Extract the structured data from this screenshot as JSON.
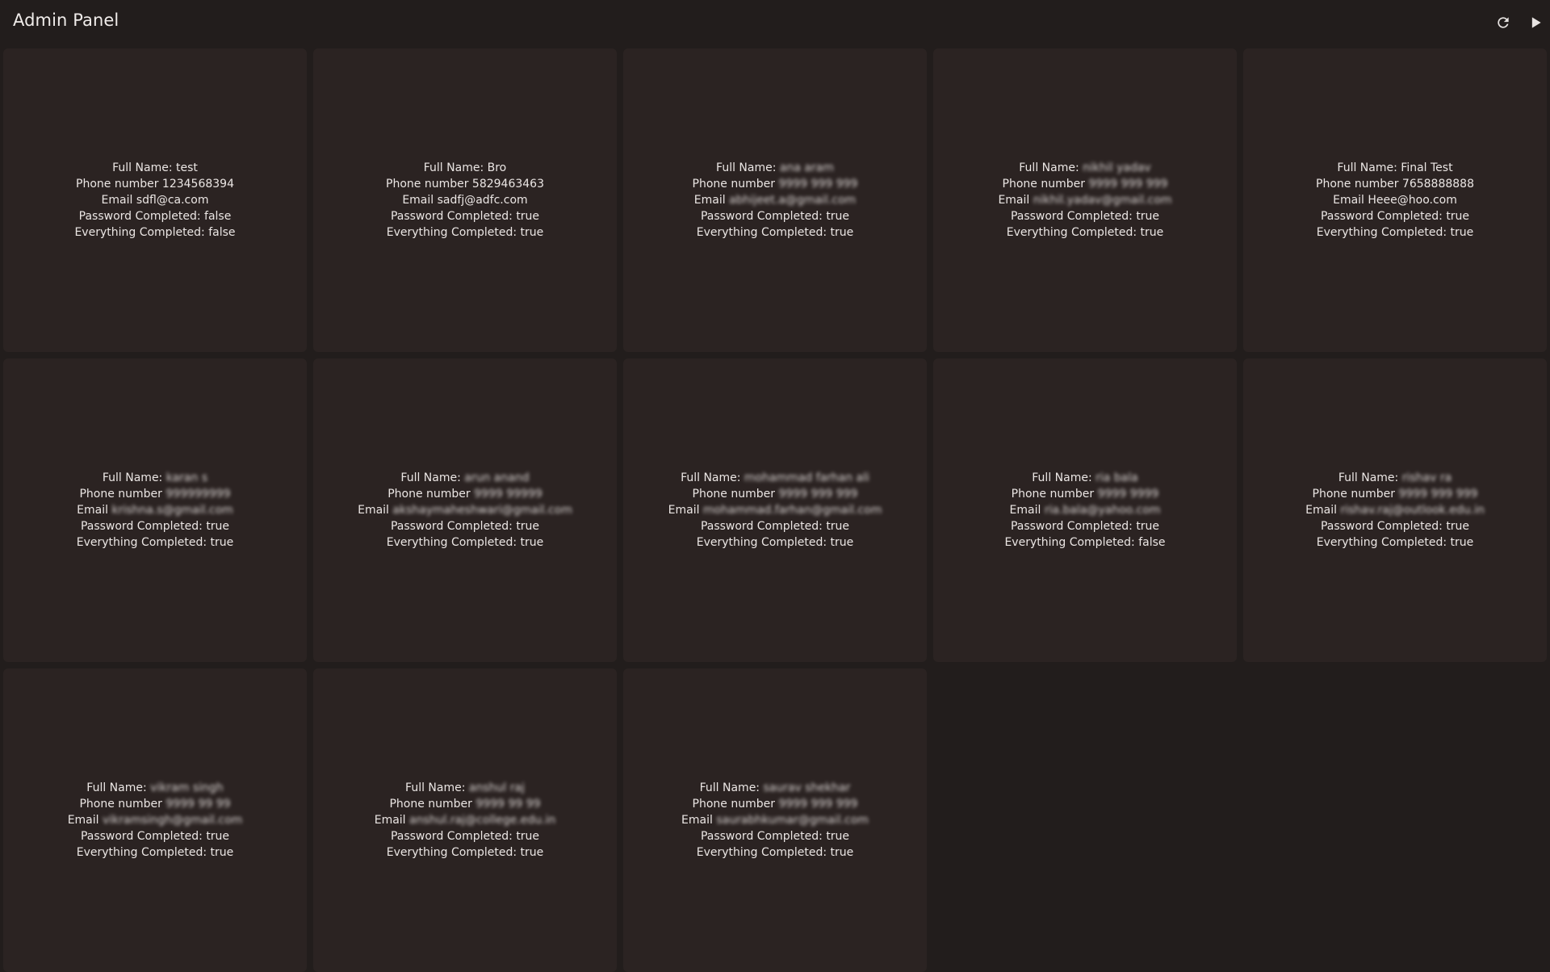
{
  "header": {
    "title": "Admin Panel",
    "refresh_icon": "refresh-icon",
    "play_icon": "play-icon"
  },
  "labels": {
    "full_name": "Full Name: ",
    "phone": "Phone number ",
    "email": "Email ",
    "password": "Password Completed: ",
    "everything": "Everything Completed: "
  },
  "users": [
    {
      "full_name": "test",
      "phone": "1234568394",
      "email": "sdfl@ca.com",
      "password_completed": "false",
      "everything_completed": "false",
      "redacted": false
    },
    {
      "full_name": "Bro",
      "phone": "5829463463",
      "email": "sadfj@adfc.com",
      "password_completed": "true",
      "everything_completed": "true",
      "redacted": false
    },
    {
      "full_name": "ana aram",
      "phone": "9999 999 999",
      "email": "abhijeet.a@gmail.com",
      "password_completed": "true",
      "everything_completed": "true",
      "redacted": true
    },
    {
      "full_name": "nikhil yadav",
      "phone": "9999 999 999",
      "email": "nikhil.yadav@gmail.com",
      "password_completed": "true",
      "everything_completed": "true",
      "redacted": true
    },
    {
      "full_name": "Final Test",
      "phone": "7658888888",
      "email": "Heee@hoo.com",
      "password_completed": "true",
      "everything_completed": "true",
      "redacted": false
    },
    {
      "full_name": "karan s",
      "phone": "999999999",
      "email": "krishna.s@gmail.com",
      "password_completed": "true",
      "everything_completed": "true",
      "redacted": true
    },
    {
      "full_name": "arun anand",
      "phone": "9999 99999",
      "email": "akshaymaheshwari@gmail.com",
      "password_completed": "true",
      "everything_completed": "true",
      "redacted": true
    },
    {
      "full_name": "mohammad farhan ali",
      "phone": "9999 999 999",
      "email": "mohammad.farhan@gmail.com",
      "password_completed": "true",
      "everything_completed": "true",
      "redacted": true
    },
    {
      "full_name": "ria bala",
      "phone": "9999 9999",
      "email": "ria.bala@yahoo.com",
      "password_completed": "true",
      "everything_completed": "false",
      "redacted": true
    },
    {
      "full_name": "rishav ra",
      "phone": "9999 999 999",
      "email": "rishav.raj@outlook.edu.in",
      "password_completed": "true",
      "everything_completed": "true",
      "redacted": true
    },
    {
      "full_name": "vikram singh",
      "phone": "9999 99 99",
      "email": "vikramsingh@gmail.com",
      "password_completed": "true",
      "everything_completed": "true",
      "redacted": true
    },
    {
      "full_name": "anshul raj",
      "phone": "9999 99 99",
      "email": "anshul.raj@college.edu.in",
      "password_completed": "true",
      "everything_completed": "true",
      "redacted": true
    },
    {
      "full_name": "saurav shekhar",
      "phone": "9999 999 999",
      "email": "saurabhkumar@gmail.com",
      "password_completed": "true",
      "everything_completed": "true",
      "redacted": true
    }
  ]
}
